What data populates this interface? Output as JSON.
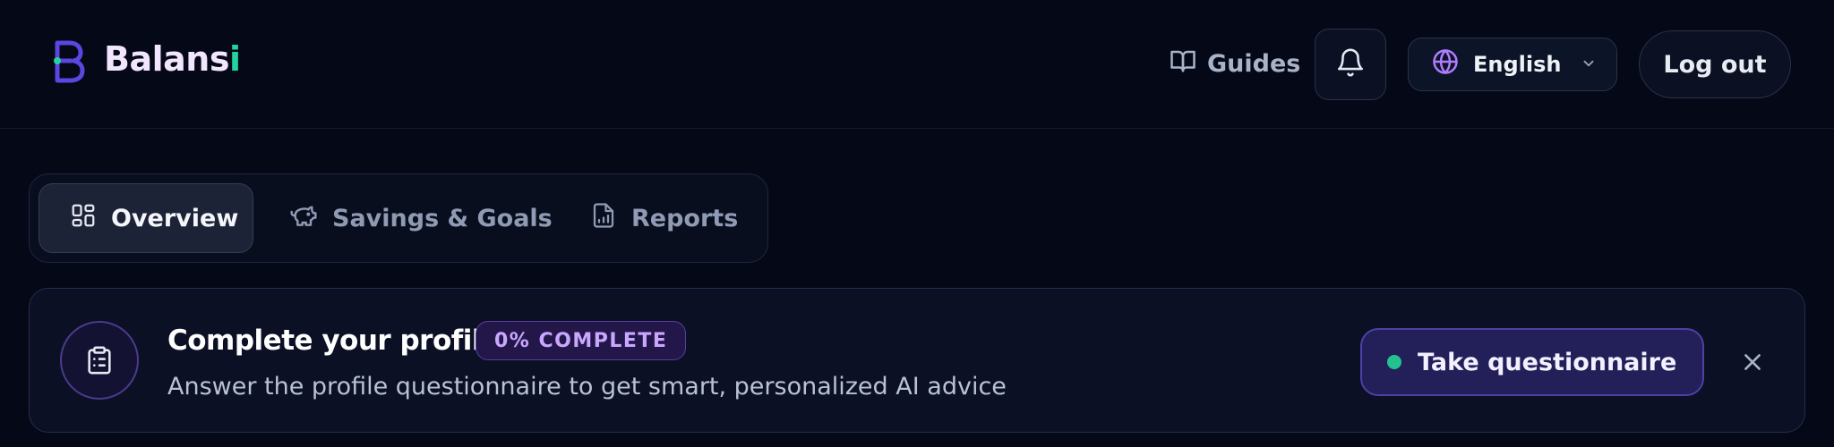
{
  "header": {
    "brand": {
      "name": "Balans",
      "accent": "i",
      "accent_color": "#22d3a0"
    },
    "guides_label": "Guides",
    "guides_icon": "book-open-icon",
    "notifications_icon": "bell-icon",
    "language": {
      "icon": "globe-icon",
      "selected": "English",
      "chevron_icon": "chevron-down-icon"
    },
    "logout_label": "Log out"
  },
  "tabs": [
    {
      "label": "Overview",
      "icon": "dashboard-grid-icon",
      "active": true
    },
    {
      "label": "Savings & Goals",
      "icon": "piggy-bank-icon",
      "active": false
    },
    {
      "label": "Reports",
      "icon": "report-file-icon",
      "active": false
    }
  ],
  "profile_banner": {
    "icon": "clipboard-list-icon",
    "title": "Complete your profile",
    "badge": "0% COMPLETE",
    "progress_percent": 0,
    "subtitle": "Answer the profile questionnaire to get smart, personalized AI advice",
    "cta_label": "Take questionnaire",
    "close_icon": "close-icon"
  },
  "colors": {
    "background": "#050816",
    "accent_purple": "#4f3fa8",
    "accent_green": "#22c38e"
  }
}
